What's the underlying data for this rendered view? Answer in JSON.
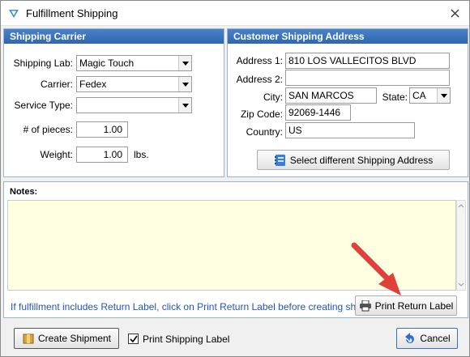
{
  "window": {
    "title": "Fulfillment Shipping"
  },
  "carrier_group": {
    "title": "Shipping Carrier",
    "shipping_lab_label": "Shipping Lab:",
    "shipping_lab_value": "Magic Touch",
    "carrier_label": "Carrier:",
    "carrier_value": "Fedex",
    "service_type_label": "Service Type:",
    "service_type_value": "",
    "pieces_label": "# of pieces:",
    "pieces_value": "1.00",
    "weight_label": "Weight:",
    "weight_value": "1.00",
    "weight_unit": "lbs."
  },
  "address_group": {
    "title": "Customer Shipping Address",
    "address1_label": "Address 1:",
    "address1_value": "810 LOS VALLECITOS BLVD",
    "address2_label": "Address 2:",
    "address2_value": "",
    "city_label": "City:",
    "city_value": "SAN MARCOS",
    "state_label": "State:",
    "state_value": "CA",
    "zip_label": "Zip Code:",
    "zip_value": "92069-1446",
    "country_label": "Country:",
    "country_value": "US",
    "select_address_button": "Select different Shipping Address"
  },
  "notes": {
    "label": "Notes:",
    "value": "",
    "hint": "If fulfillment includes Return Label, click on Print Return Label before creating shipment",
    "print_return_label_button": "Print Return Label"
  },
  "footer": {
    "create_shipment_button": "Create Shipment",
    "print_shipping_label_checkbox": "Print Shipping Label",
    "print_shipping_label_checked": true,
    "cancel_button": "Cancel"
  },
  "icons": {
    "app": "app-logo-icon",
    "close": "close-icon",
    "dropdown": "chevron-down-icon",
    "address_book": "address-book-icon",
    "printer": "printer-icon",
    "shipment": "package-icon",
    "cancel": "undo-arrow-icon",
    "annotation": "red-arrow-annotation"
  },
  "colors": {
    "header_blue": "#2f66b1",
    "notes_bg": "#ffffe1",
    "hint_text": "#2155b8",
    "annotation_red": "#e0403a"
  }
}
